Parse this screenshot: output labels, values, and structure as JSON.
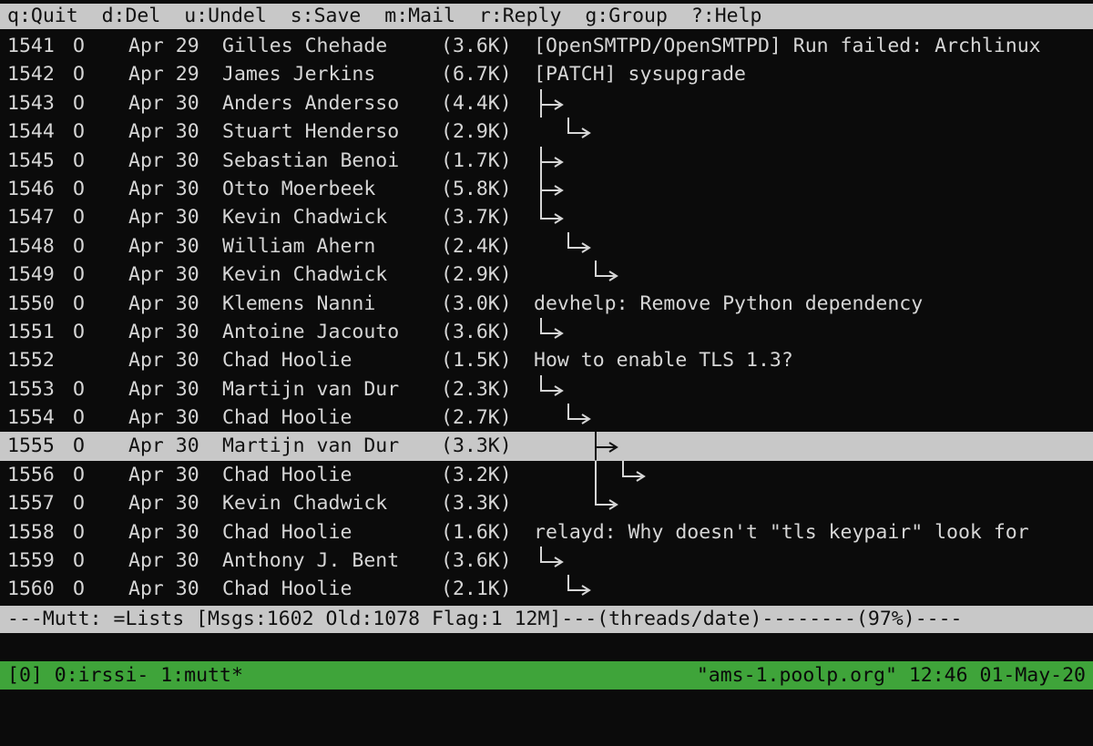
{
  "help_bar": {
    "items": [
      {
        "key": "q",
        "label": "Quit"
      },
      {
        "key": "d",
        "label": "Del"
      },
      {
        "key": "u",
        "label": "Undel"
      },
      {
        "key": "s",
        "label": "Save"
      },
      {
        "key": "m",
        "label": "Mail"
      },
      {
        "key": "r",
        "label": "Reply"
      },
      {
        "key": "g",
        "label": "Group"
      },
      {
        "key": "?",
        "label": "Help"
      }
    ]
  },
  "messages": [
    {
      "num": "1541",
      "flag": "O",
      "date": "Apr 29",
      "from": "Gilles Chehade",
      "size": "(3.6K)",
      "subject": "[OpenSMTPD/OpenSMTPD] Run failed: Archlinux"
    },
    {
      "num": "1542",
      "flag": "O",
      "date": "Apr 29",
      "from": "James Jerkins",
      "size": "(6.7K)",
      "subject": "[PATCH] sysupgrade"
    },
    {
      "num": "1543",
      "flag": "O",
      "date": "Apr 30",
      "from": "Anders Andersso",
      "size": "(4.4K)",
      "subject": "",
      "tree_depth": 0,
      "tree_shape": "tee"
    },
    {
      "num": "1544",
      "flag": "O",
      "date": "Apr 30",
      "from": "Stuart Henderso",
      "size": "(2.9K)",
      "subject": "",
      "tree_depth": 1,
      "tree_shape": "corner"
    },
    {
      "num": "1545",
      "flag": "O",
      "date": "Apr 30",
      "from": "Sebastian Benoi",
      "size": "(1.7K)",
      "subject": "",
      "tree_depth": 0,
      "tree_shape": "tee"
    },
    {
      "num": "1546",
      "flag": "O",
      "date": "Apr 30",
      "from": "Otto Moerbeek",
      "size": "(5.8K)",
      "subject": "",
      "tree_depth": 0,
      "tree_shape": "tee"
    },
    {
      "num": "1547",
      "flag": "O",
      "date": "Apr 30",
      "from": "Kevin Chadwick",
      "size": "(3.7K)",
      "subject": "",
      "tree_depth": 0,
      "tree_shape": "corner"
    },
    {
      "num": "1548",
      "flag": "O",
      "date": "Apr 30",
      "from": "William Ahern",
      "size": "(2.4K)",
      "subject": "",
      "tree_depth": 1,
      "tree_shape": "corner"
    },
    {
      "num": "1549",
      "flag": "O",
      "date": "Apr 30",
      "from": "Kevin Chadwick",
      "size": "(2.9K)",
      "subject": "",
      "tree_depth": 2,
      "tree_shape": "corner"
    },
    {
      "num": "1550",
      "flag": "O",
      "date": "Apr 30",
      "from": "Klemens Nanni",
      "size": "(3.0K)",
      "subject": "devhelp: Remove Python dependency"
    },
    {
      "num": "1551",
      "flag": "O",
      "date": "Apr 30",
      "from": "Antoine Jacouto",
      "size": "(3.6K)",
      "subject": "",
      "tree_depth": 0,
      "tree_shape": "corner"
    },
    {
      "num": "1552",
      "flag": "",
      "date": "Apr 30",
      "from": "Chad Hoolie",
      "size": "(1.5K)",
      "subject": "How to enable TLS 1.3?"
    },
    {
      "num": "1553",
      "flag": "O",
      "date": "Apr 30",
      "from": "Martijn van Dur",
      "size": "(2.3K)",
      "subject": "",
      "tree_depth": 0,
      "tree_shape": "corner"
    },
    {
      "num": "1554",
      "flag": "O",
      "date": "Apr 30",
      "from": "Chad Hoolie",
      "size": "(2.7K)",
      "subject": "",
      "tree_depth": 1,
      "tree_shape": "corner"
    },
    {
      "num": "1555",
      "flag": "O",
      "date": "Apr 30",
      "from": "Martijn van Dur",
      "size": "(3.3K)",
      "subject": "",
      "tree_depth": 2,
      "tree_shape": "tee",
      "selected": true
    },
    {
      "num": "1556",
      "flag": "O",
      "date": "Apr 30",
      "from": "Chad Hoolie",
      "size": "(3.2K)",
      "subject": "",
      "tree_depth": 3,
      "tree_shape": "corner",
      "tree_pipes": [
        2
      ]
    },
    {
      "num": "1557",
      "flag": "O",
      "date": "Apr 30",
      "from": "Kevin Chadwick",
      "size": "(3.3K)",
      "subject": "",
      "tree_depth": 2,
      "tree_shape": "corner"
    },
    {
      "num": "1558",
      "flag": "O",
      "date": "Apr 30",
      "from": "Chad Hoolie",
      "size": "(1.6K)",
      "subject": "relayd: Why doesn't \"tls keypair\" look for"
    },
    {
      "num": "1559",
      "flag": "O",
      "date": "Apr 30",
      "from": "Anthony J. Bent",
      "size": "(3.6K)",
      "subject": "",
      "tree_depth": 0,
      "tree_shape": "corner"
    },
    {
      "num": "1560",
      "flag": "O",
      "date": "Apr 30",
      "from": "Chad Hoolie",
      "size": "(2.1K)",
      "subject": "",
      "tree_depth": 1,
      "tree_shape": "corner"
    }
  ],
  "status_bar": {
    "text": "---Mutt: =Lists [Msgs:1602 Old:1078 Flag:1 12M]---(threads/date)--------(97%)----"
  },
  "tmux": {
    "left": "[0] 0:irssi- 1:mutt*",
    "right": "\"ams-1.poolp.org\" 12:46 01-May-20"
  }
}
